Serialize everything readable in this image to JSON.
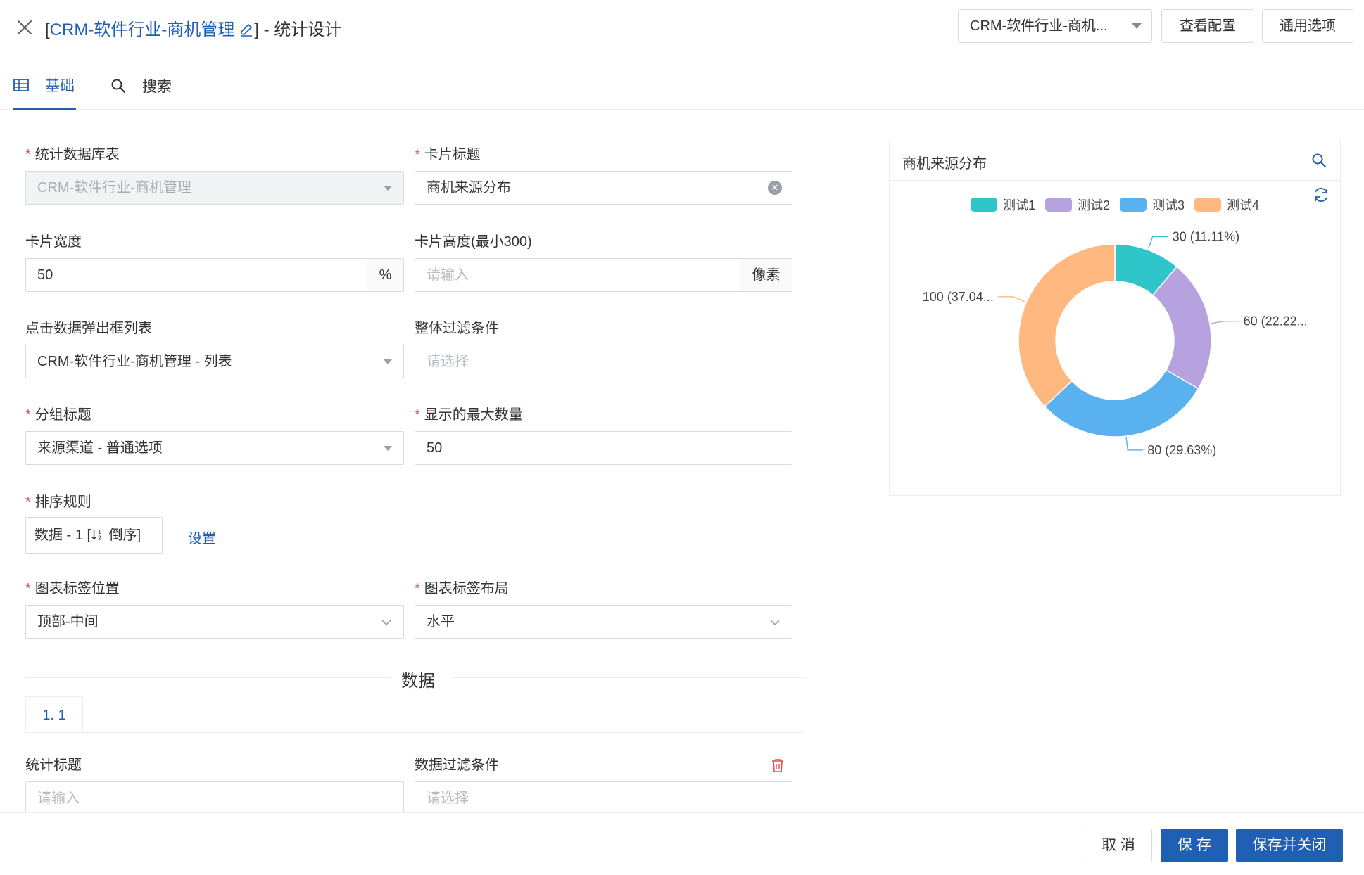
{
  "header": {
    "title_prefix": "[",
    "title_link": "CRM-软件行业-商机管理",
    "title_suffix": "] - 统计设计",
    "select_value": "CRM-软件行业-商机...",
    "view_config": "查看配置",
    "general_options": "通用选项"
  },
  "tabs": [
    {
      "label": "基础",
      "icon": "table-icon"
    },
    {
      "label": "搜索",
      "icon": "search-icon"
    }
  ],
  "form": {
    "db_table": {
      "label": "统计数据库表",
      "value": "CRM-软件行业-商机管理"
    },
    "card_title": {
      "label": "卡片标题",
      "value": "商机来源分布"
    },
    "card_width": {
      "label": "卡片宽度",
      "value": "50",
      "unit": "%"
    },
    "card_height": {
      "label": "卡片高度(最小300)",
      "placeholder": "请输入",
      "unit": "像素"
    },
    "popup_list": {
      "label": "点击数据弹出框列表",
      "value": "CRM-软件行业-商机管理 - 列表"
    },
    "global_filter": {
      "label": "整体过滤条件",
      "placeholder": "请选择"
    },
    "group_title": {
      "label": "分组标题",
      "value": "来源渠道 - 普通选项"
    },
    "max_count": {
      "label": "显示的最大数量",
      "value": "50"
    },
    "sort_rule": {
      "label": "排序规则",
      "prefix": "数据 - 1 [",
      "suffix": " 倒序]",
      "set_link": "设置"
    },
    "label_position": {
      "label": "图表标签位置",
      "value": "顶部-中间"
    },
    "label_layout": {
      "label": "图表标签布局",
      "value": "水平"
    }
  },
  "data_section": {
    "title": "数据",
    "tab": "1. 1",
    "stat_title": {
      "label": "统计标题",
      "placeholder": "请输入"
    },
    "data_filter": {
      "label": "数据过滤条件",
      "placeholder": "请选择"
    }
  },
  "chart_data": {
    "type": "pie",
    "title": "商机来源分布",
    "donut": true,
    "categories": [
      "测试1",
      "测试2",
      "测试3",
      "测试4"
    ],
    "values": [
      30,
      60,
      80,
      100
    ],
    "labels": [
      "30 (11.11%)",
      "60 (22.22...",
      "80 (29.63%)",
      "100 (37.04..."
    ],
    "colors": [
      "#2ec6c8",
      "#b6a2de",
      "#5ab1ef",
      "#ffb980"
    ],
    "legend": "top-center"
  },
  "footer": {
    "cancel": "取 消",
    "save": "保 存",
    "save_close": "保存并关闭"
  }
}
